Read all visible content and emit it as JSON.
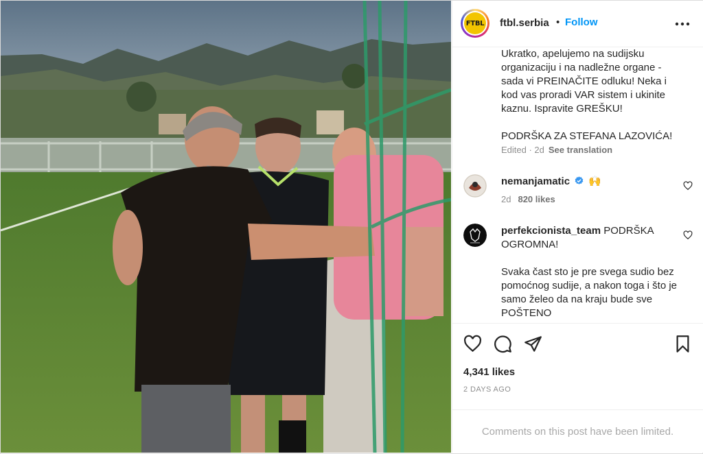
{
  "post": {
    "username": "ftbl.serbia",
    "avatar_text": "FTBL",
    "separator": "•",
    "follow_label": "Follow",
    "more_icon": "more-horizontal-icon"
  },
  "caption": {
    "text": "Ukratko, apelujemo na sudijsku organizaciju i na nadležne organe - sada vi PREINAČITE odluku! Neka i kod vas proradi VAR sistem i ukinite kaznu. Ispravite GREŠKU!\n\nPODRŠKA ZA STEFANA LAZOVIĆA!",
    "edited_label": "Edited · 2d",
    "see_translation": "See translation"
  },
  "comments": [
    {
      "username": "nemanjamatic",
      "verified": true,
      "text": "🙌",
      "age": "2d",
      "likes": "820 likes"
    },
    {
      "username": "perfekcionista_team",
      "text_first": "PODRŠKA OGROMNA!",
      "text_rest": "Svaka čast sto je pre svega sudio bez pomoćnog sudije, a nakon toga i što je samo želeo da na kraju bude sve POŠTENO"
    }
  ],
  "actions": {
    "likes": "4,341 likes",
    "date": "2 DAYS AGO",
    "icons": [
      "heart-icon",
      "comment-icon",
      "share-icon",
      "bookmark-icon"
    ]
  },
  "footer": {
    "limited_text": "Comments on this post have been limited."
  },
  "colors": {
    "follow_blue": "#0095f6",
    "text": "#262626",
    "muted": "#8e8e8e",
    "verified_blue": "#3897f0",
    "border": "#efefef"
  }
}
